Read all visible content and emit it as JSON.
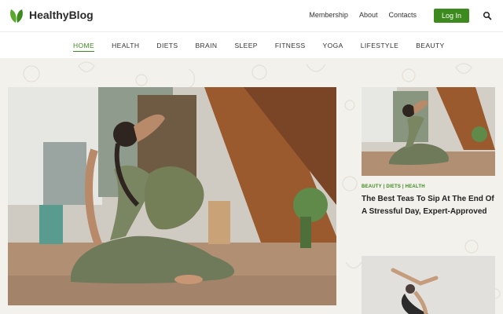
{
  "brand": {
    "name": "HealthyBlog",
    "logo_icon": "leaf-icon",
    "accent": "#3d8b1e"
  },
  "header": {
    "links": [
      "Membership",
      "About",
      "Contacts"
    ],
    "login_label": "Log In",
    "search_icon": "search-icon"
  },
  "nav": {
    "items": [
      "HOME",
      "HEALTH",
      "DIETS",
      "BRAIN",
      "SLEEP",
      "FITNESS",
      "YOGA",
      "LIFESTYLE",
      "BEAUTY"
    ],
    "active": "HOME"
  },
  "side_article": {
    "tags": "BEAUTY | DIETS | HEALTH",
    "title": "The Best Teas To Sip At The End Of A Stressful Day, Expert-Approved"
  }
}
